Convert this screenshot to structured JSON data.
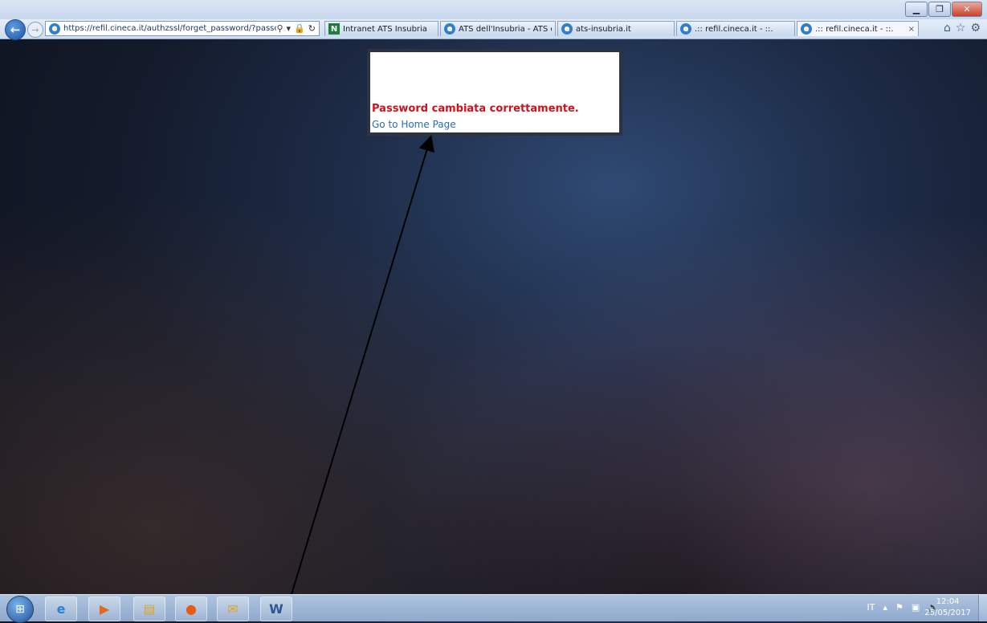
{
  "browser": {
    "address_url": "https://refil.cineca.it/authzssl/forget_password/?passch",
    "tabs": [
      {
        "label": "Intranet ATS Insubria",
        "icon": "intranet-logo",
        "active": false
      },
      {
        "label": "ATS dell'Insubria - ATS d...",
        "icon": "ie-icon",
        "active": false
      },
      {
        "label": "ats-insubria.it",
        "icon": "ie-icon",
        "active": false
      },
      {
        "label": ".:: refil.cineca.it - ::.",
        "icon": "ie-icon",
        "active": false
      },
      {
        "label": ".:: refil.cineca.it - ::.",
        "icon": "ie-icon",
        "active": true
      }
    ],
    "tab_close_glyph": "×"
  },
  "page": {
    "message": "Password cambiata correttamente.",
    "home_link": "Go to Home Page"
  },
  "taskbar": {
    "tray_language": "IT",
    "time": "12:04",
    "date": "25/05/2017"
  },
  "colors": {
    "message_red": "#d0101b",
    "link_blue": "#2a6bb5",
    "content_frame": "#2c3342"
  }
}
